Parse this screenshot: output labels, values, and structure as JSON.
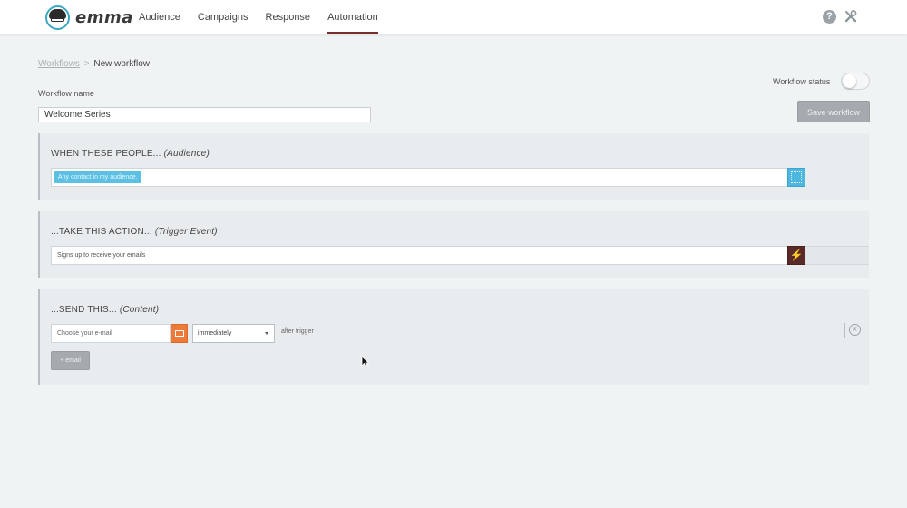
{
  "brand": {
    "name": "emma"
  },
  "nav": {
    "items": [
      {
        "label": "Audience"
      },
      {
        "label": "Campaigns"
      },
      {
        "label": "Response"
      },
      {
        "label": "Automation",
        "active": true
      }
    ],
    "help_icon": "question-circle-icon",
    "tools_icon": "tools-icon"
  },
  "breadcrumb": {
    "parent": "Workflows",
    "separator": ">",
    "current": "New workflow"
  },
  "workflow": {
    "name_label": "Workflow name",
    "name_value": "Welcome Series",
    "status_label": "Workflow status",
    "status_on": false,
    "save_label": "Save workflow"
  },
  "audience": {
    "title": "WHEN THESE PEOPLE...",
    "subtitle": "(Audience)",
    "tag": "Any contact in my audience.",
    "accent": "#4db7e0"
  },
  "trigger": {
    "title": "...TAKE THIS ACTION...",
    "subtitle": "(Trigger Event)",
    "value": "Signs up to receive your emails",
    "accent": "#5a2a28",
    "icon": "lightning-bolt-icon"
  },
  "content": {
    "title": "...SEND THIS...",
    "subtitle": "(Content)",
    "email_placeholder": "Choose your e-mail",
    "email_icon": "envelope-icon",
    "timing_value": "immediately",
    "after_text": "after trigger",
    "add_email_label": "+ email",
    "accent": "#ee7a3a"
  }
}
